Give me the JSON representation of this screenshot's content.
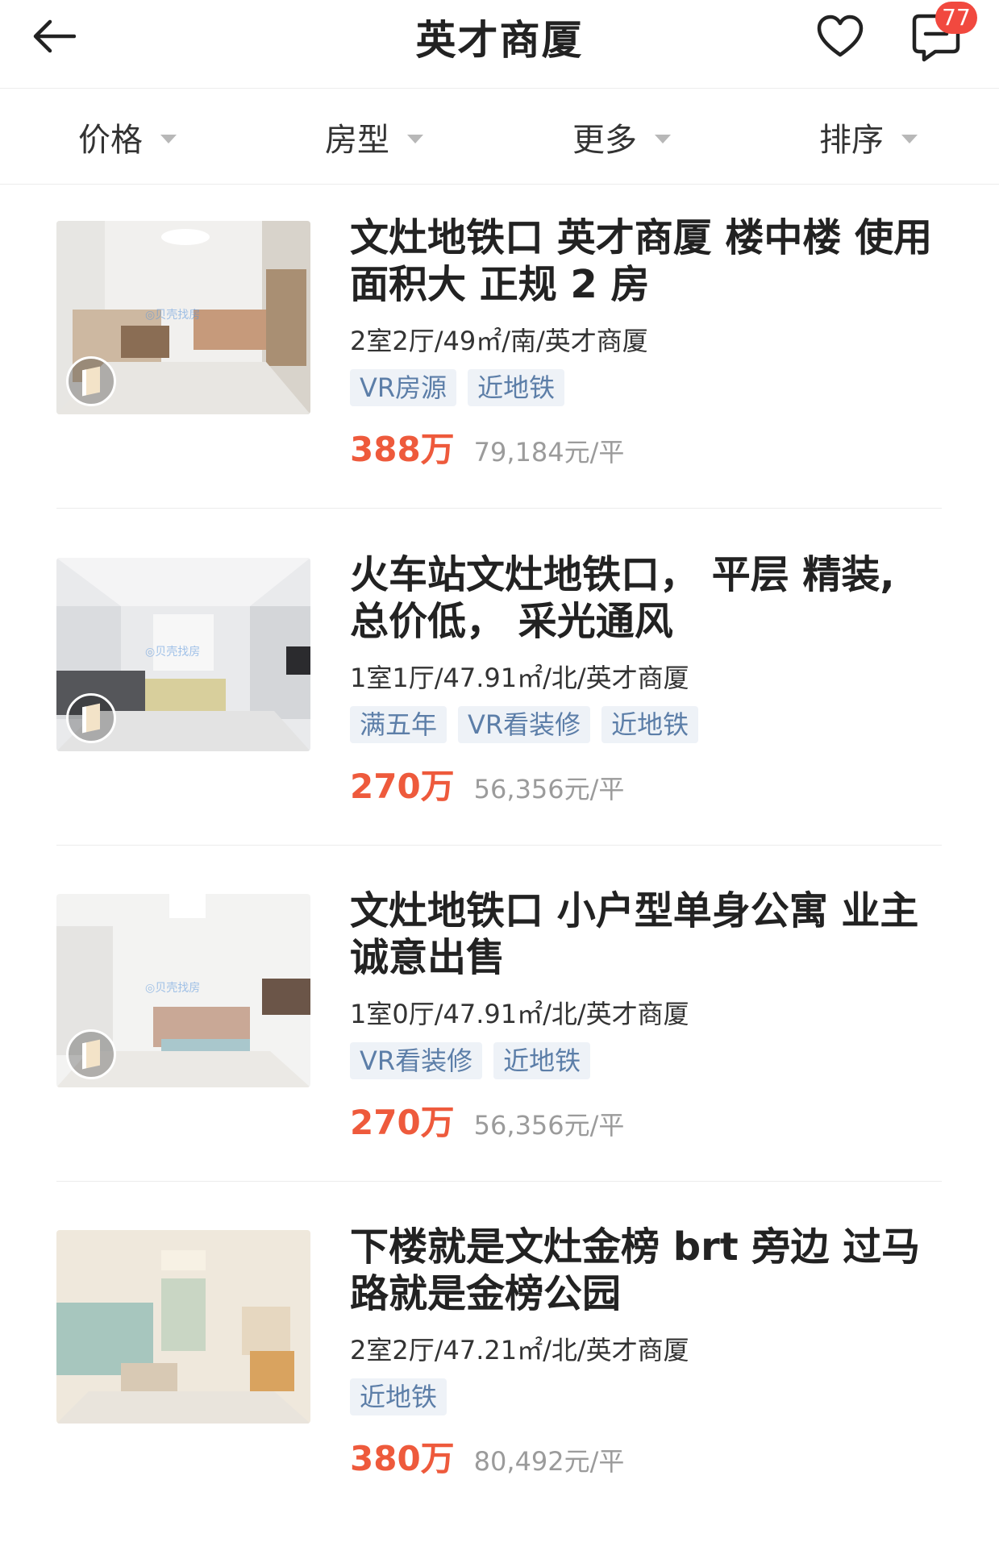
{
  "header": {
    "title": "英才商厦",
    "message_badge": "77",
    "icons": {
      "back": "back-arrow-icon",
      "favorite": "heart-icon",
      "messages": "message-icon"
    }
  },
  "filters": [
    {
      "label": "价格"
    },
    {
      "label": "房型"
    },
    {
      "label": "更多"
    },
    {
      "label": "排序"
    }
  ],
  "listings": [
    {
      "title": "文灶地铁口 英才商厦 楼中楼 使用面积大 正规 2 房",
      "meta": "2室2厅/49㎡/南/英才商厦",
      "tags": [
        "VR房源",
        "近地铁"
      ],
      "price": "388万",
      "unit_price": "79,184元/平"
    },
    {
      "title": "火车站文灶地铁口， 平层 精装, 总价低， 采光通风",
      "meta": "1室1厅/47.91㎡/北/英才商厦",
      "tags": [
        "满五年",
        "VR看装修",
        "近地铁"
      ],
      "price": "270万",
      "unit_price": "56,356元/平"
    },
    {
      "title": "文灶地铁口 小户型单身公寓 业主诚意出售",
      "meta": "1室0厅/47.91㎡/北/英才商厦",
      "tags": [
        "VR看装修",
        "近地铁"
      ],
      "price": "270万",
      "unit_price": "56,356元/平"
    },
    {
      "title": "下楼就是文灶金榜 brt 旁边 过马路就是金榜公园",
      "meta": "2室2厅/47.21㎡/北/英才商厦",
      "tags": [
        "近地铁"
      ],
      "price": "380万",
      "unit_price": "80,492元/平"
    }
  ],
  "colors": {
    "price": "#ee5a3c",
    "tag_bg": "#eef2f7",
    "tag_text": "#5c7ea8",
    "badge": "#f1493f"
  }
}
